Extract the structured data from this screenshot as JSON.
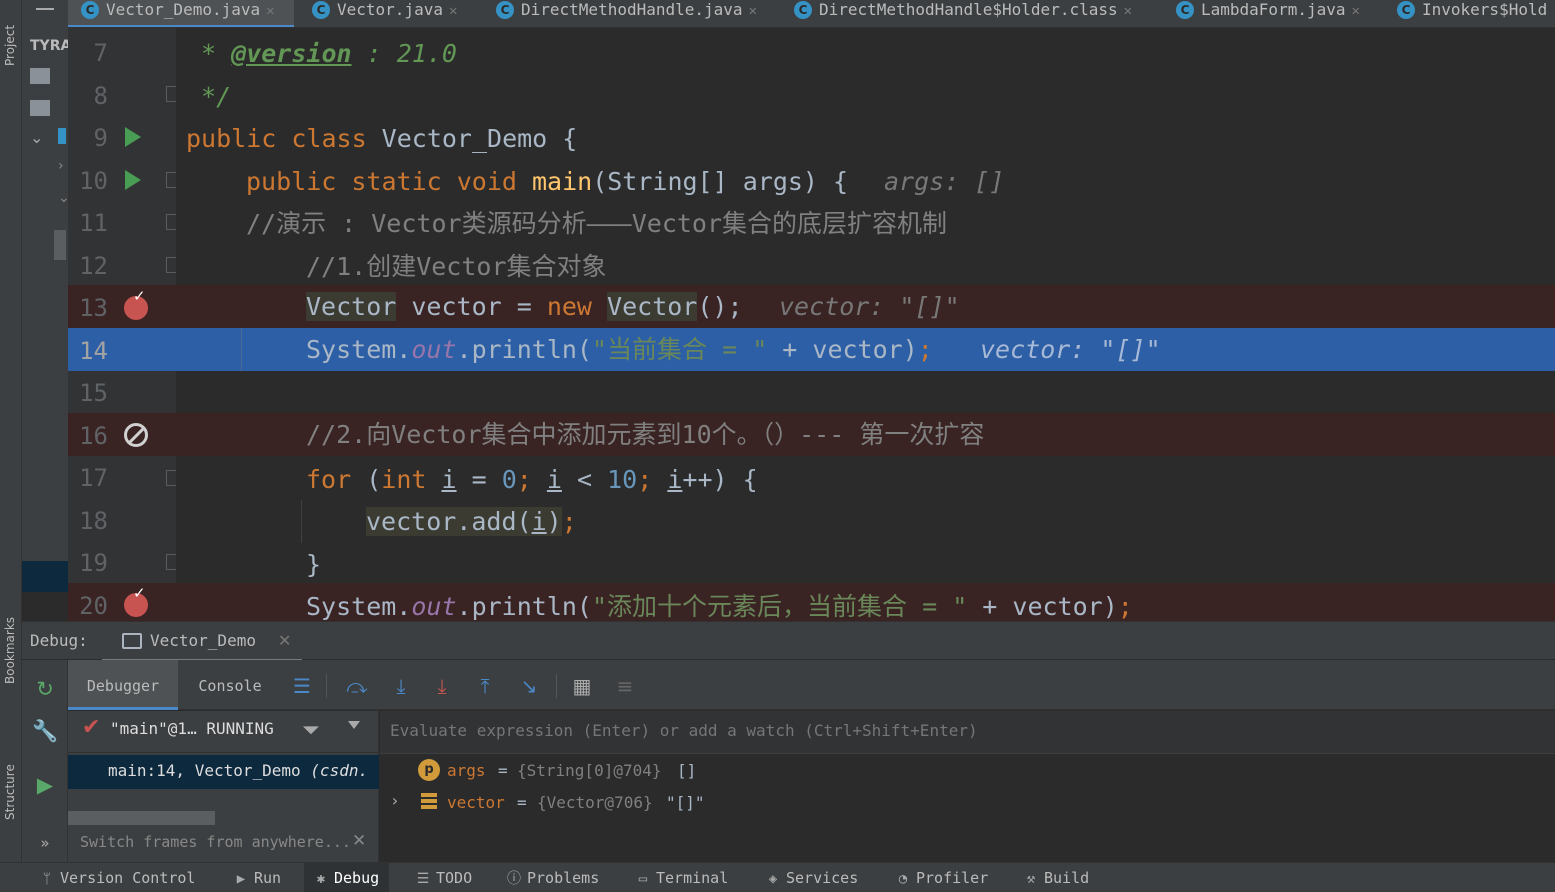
{
  "tool_windows": {
    "project": "Project",
    "bookmarks": "Bookmarks",
    "structure": "Structure",
    "project_root": "TYRA"
  },
  "file_tabs": [
    {
      "label": "Vector_Demo.java",
      "icon": "C",
      "active": true
    },
    {
      "label": "Vector.java",
      "icon": "C"
    },
    {
      "label": "DirectMethodHandle.java",
      "icon": "C"
    },
    {
      "label": "DirectMethodHandle$Holder.class",
      "icon": "C"
    },
    {
      "label": "LambdaForm.java",
      "icon": "C"
    },
    {
      "label": "Invokers$Hold",
      "icon": "C"
    }
  ],
  "editor": {
    "current_line": 14,
    "lines": [
      {
        "n": "7"
      },
      {
        "n": "8"
      },
      {
        "n": "9"
      },
      {
        "n": "10"
      },
      {
        "n": "11"
      },
      {
        "n": "12"
      },
      {
        "n": "13"
      },
      {
        "n": "14"
      },
      {
        "n": "15"
      },
      {
        "n": "16"
      },
      {
        "n": "17"
      },
      {
        "n": "18"
      },
      {
        "n": "19"
      },
      {
        "n": "20"
      }
    ],
    "code": {
      "l7_star": " * ",
      "l7_tag": "@version",
      "l7_rest": " : 21.0",
      "l8": " */",
      "l9_kw": "public class ",
      "l9_rest": "Vector_Demo {",
      "l10_kw": "public static void ",
      "l10_fn": "main",
      "l10_rest": "(String[] args) {",
      "l10_hint": "args: []",
      "l11": "//演示 : Vector类源码分析———Vector集合的底层扩容机制",
      "l12": "//1.创建Vector集合对象",
      "l13_type": "Vector",
      "l13_mid": " vector = ",
      "l13_new": "new ",
      "l13_ctor": "Vector",
      "l13_end": "();",
      "l13_hint": "vector: \"[]\"",
      "l14_a": "System.",
      "l14_out": "out",
      "l14_b": ".println(",
      "l14_str": "\"当前集合 = \"",
      "l14_c": " + vector)",
      "l14_semi": ";",
      "l14_hint": "vector: \"[]\"",
      "l16": "//2.向Vector集合中添加元素到10个。（）--- 第一次扩容",
      "l17_for": "for ",
      "l17_p1": "(",
      "l17_int": "int ",
      "l17_i1": "i",
      "l17_eq": " = ",
      "l17_zero": "0",
      "l17_semi1": "; ",
      "l17_i2": "i",
      "l17_lt": " < ",
      "l17_ten": "10",
      "l17_semi2": "; ",
      "l17_i3": "i",
      "l17_end": "++) {",
      "l18_call": "vector.add(",
      "l18_i": "i",
      "l18_end": ")",
      "l18_semi": ";",
      "l19": "}",
      "l20_a": "System.",
      "l20_out": "out",
      "l20_b": ".println(",
      "l20_str": "\"添加十个元素后，当前集合 = \"",
      "l20_c": " + vector)",
      "l20_semi": ";"
    }
  },
  "debug": {
    "label": "Debug:",
    "session": "Vector_Demo",
    "tabs": [
      "Debugger",
      "Console"
    ],
    "thread": "\"main\"@1… RUNNING",
    "frame": "main:14, Vector_Demo",
    "frame_src": "(csdn.",
    "frames_hint": "Switch frames from anywhere...",
    "watch_placeholder": "Evaluate expression (Enter) or add a watch (Ctrl+Shift+Enter)",
    "variables": [
      {
        "icon": "p",
        "name": "args",
        "eq": "=",
        "type": "{String[0]@704}",
        "value": "[]"
      },
      {
        "icon": "field",
        "name": "vector",
        "eq": "=",
        "type": "{Vector@706}",
        "value": "\"[]\""
      }
    ]
  },
  "bottom_bar": [
    {
      "label": "Version Control",
      "icon": "branch-icon"
    },
    {
      "label": "Run",
      "icon": "run-icon"
    },
    {
      "label": "Debug",
      "icon": "bug-icon",
      "active": true
    },
    {
      "label": "TODO",
      "icon": "list-icon"
    },
    {
      "label": "Problems",
      "icon": "problems-icon"
    },
    {
      "label": "Terminal",
      "icon": "terminal-icon"
    },
    {
      "label": "Services",
      "icon": "services-icon"
    },
    {
      "label": "Profiler",
      "icon": "profiler-icon"
    },
    {
      "label": "Build",
      "icon": "hammer-icon"
    }
  ],
  "colors": {
    "breakpoint_line": "#3a2323",
    "current_line": "#2d5fa6",
    "breakpoint": "#c75450",
    "run": "#499c54"
  }
}
